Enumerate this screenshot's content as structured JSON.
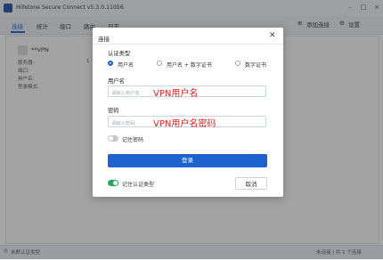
{
  "app": {
    "title": "Hillstone Secure Connect v5.3.0.11056",
    "tabs": [
      "连接",
      "统计",
      "接口",
      "路由",
      "日志"
    ],
    "add_connection": "添加连接",
    "settings": "设置",
    "vpn_name": "**VPN",
    "fields": [
      "服务器:",
      "端口:",
      "用户名:",
      "登录模式:"
    ],
    "server_value": "1",
    "status_left": "未默认证类型",
    "status_right": "未连接  |  共 1 个连接"
  },
  "dialog": {
    "title": "连接",
    "auth_type_label": "认证类型",
    "auth_options": [
      "用户名",
      "用户名 + 数字证书",
      "数字证书"
    ],
    "selected_auth": "用户名",
    "username_label": "用户名",
    "username_placeholder": "请输入用户名",
    "username_value": "VPN用户名",
    "password_label": "密码",
    "password_placeholder": "请输入密码",
    "password_value": "VPN用户名密码",
    "remember_password": "记住密码",
    "remember_password_on": false,
    "login_button": "登录",
    "remember_auth_type": "记住认证类型",
    "remember_auth_type_on": true,
    "cancel_button": "取消"
  },
  "colors": {
    "accent": "#1e62d0",
    "handwriting": "#e32222",
    "toggle_off": "#c4c8cf"
  }
}
